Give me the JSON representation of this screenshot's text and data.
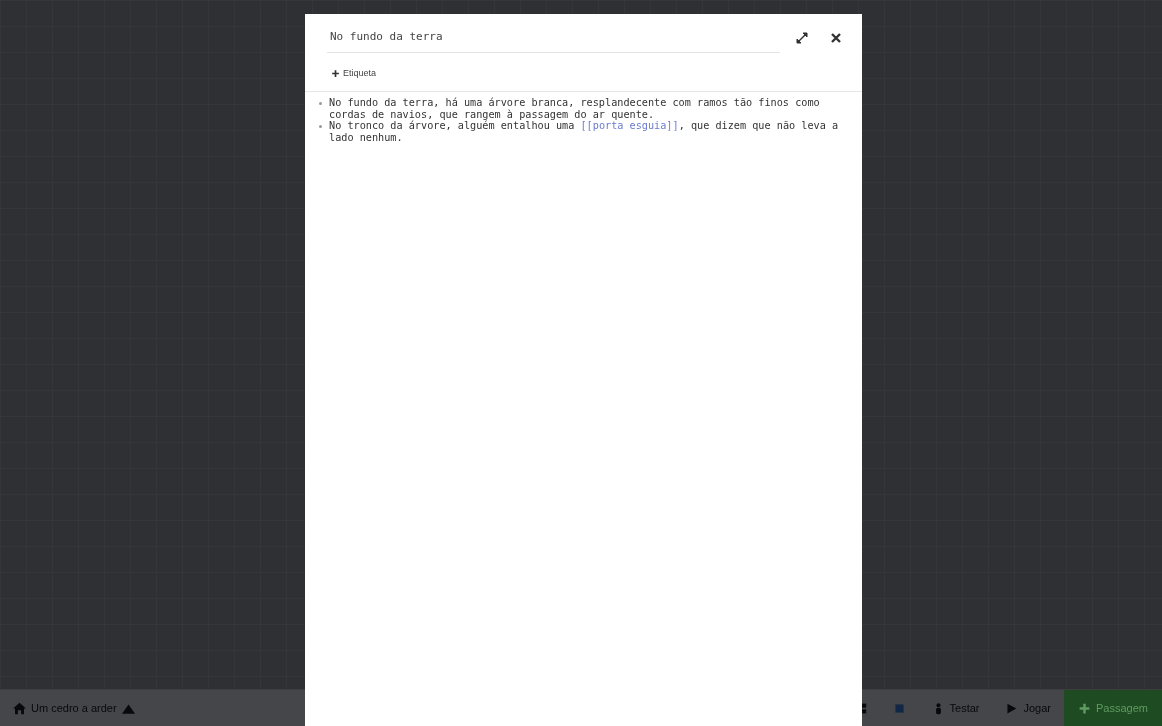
{
  "story_bar": {
    "title": "Um cedro a arder",
    "buttons": [
      {
        "kind": "icon"
      },
      {
        "kind": "icon"
      },
      {
        "kind": "text",
        "label": "Testar"
      },
      {
        "kind": "text",
        "label": "Jogar"
      },
      {
        "kind": "primary",
        "label": "Passagem"
      }
    ]
  },
  "dialog": {
    "passage_name": "No fundo da terra",
    "tag_button": "Etiqueta",
    "lines": [
      {
        "segments": [
          {
            "kind": "text",
            "text": "No fundo da terra, há uma árvore branca, resplandecente com ramos tão finos como cordas de navios, que rangem à passagem do ar quente."
          }
        ]
      },
      {
        "segments": [
          {
            "kind": "text",
            "text": "No tronco da árvore, alguém entalhou uma "
          },
          {
            "kind": "link",
            "text": "[[porta esguia]]"
          },
          {
            "kind": "text",
            "text": ", que dizem que não leva a lado nenhum."
          }
        ]
      }
    ]
  }
}
